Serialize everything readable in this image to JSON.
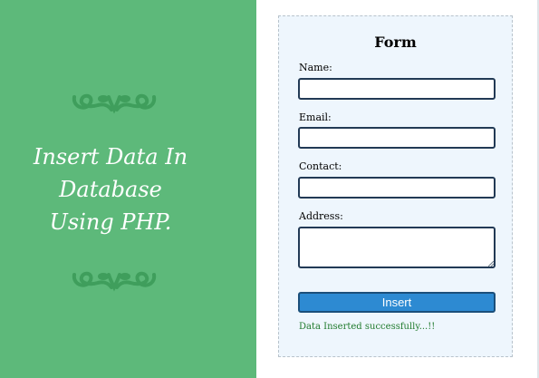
{
  "hero": {
    "title": "Insert Data In\nDatabase\nUsing PHP."
  },
  "colors": {
    "panel_green": "#5db97a",
    "ornament_green": "#3f9e5c",
    "card_background": "#eef6fd",
    "button_blue": "#2d8ad2",
    "success_green": "#1f7a2c"
  },
  "icons": {
    "ornament": "scroll-ornament-icon"
  },
  "form": {
    "heading": "Form",
    "fields": [
      {
        "label": "Name:",
        "value": ""
      },
      {
        "label": "Email:",
        "value": ""
      },
      {
        "label": "Contact:",
        "value": ""
      },
      {
        "label": "Address:",
        "value": ""
      }
    ],
    "submit_label": "Insert",
    "status_message": "Data Inserted successfully...!!"
  }
}
